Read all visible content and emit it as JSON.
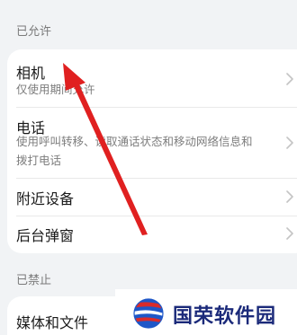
{
  "sections": {
    "allowed_header": "已允许",
    "denied_header": "已禁止"
  },
  "allowed_items": [
    {
      "title": "相机",
      "subtitle": "仅使用期间允许"
    },
    {
      "title": "电话",
      "subtitle_line1": "使用呼叫转移、读取通话状态和移动网络信息和",
      "subtitle_line2": "拨打电话"
    },
    {
      "title": "附近设备"
    },
    {
      "title": "后台弹窗"
    }
  ],
  "denied_items": [
    {
      "title": "媒体和文件"
    }
  ],
  "watermark": {
    "text": "国荣软件园"
  },
  "colors": {
    "background": "#f1f3f5",
    "card": "#ffffff",
    "annotation_arrow": "#e02020",
    "watermark_text": "#1b2a7a"
  },
  "icons": {
    "chevron": "chevron-right-icon",
    "annotation": "red-arrow-annotation"
  }
}
